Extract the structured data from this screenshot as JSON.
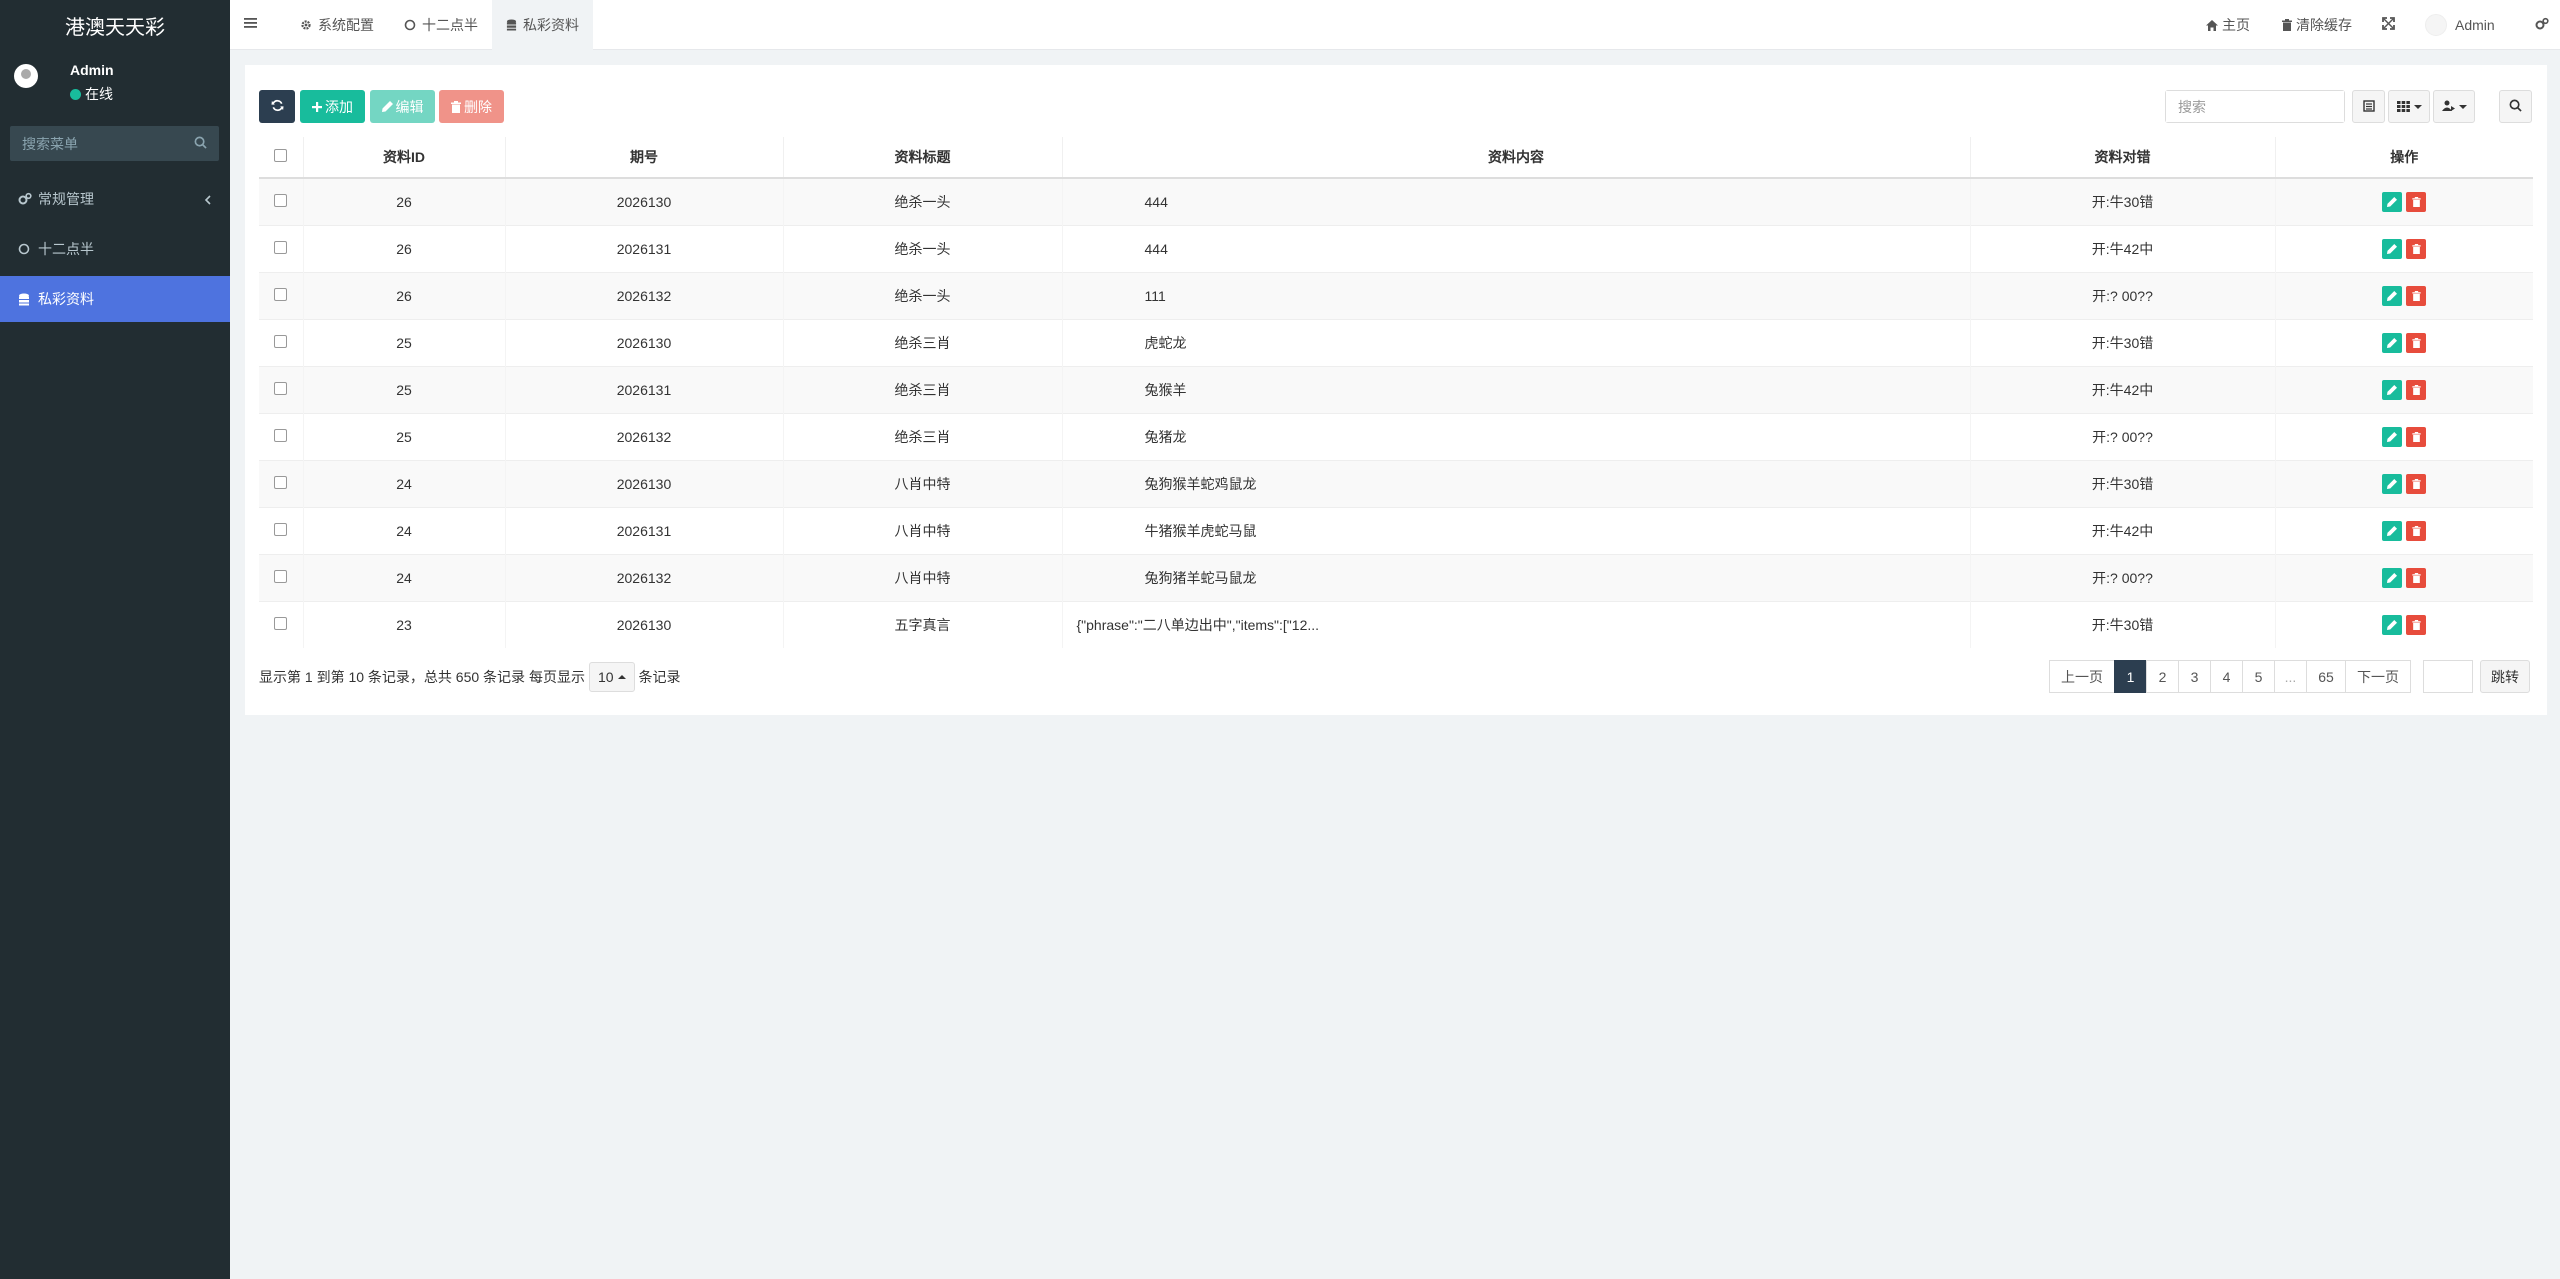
{
  "app": {
    "logo": "港澳天天彩"
  },
  "user": {
    "name": "Admin",
    "status": "在线"
  },
  "sidebar": {
    "search_placeholder": "搜索菜单",
    "items": [
      {
        "label": "常规管理",
        "icon": "cogs-icon"
      },
      {
        "label": "十二点半",
        "icon": "circle-icon"
      },
      {
        "label": "私彩资料",
        "icon": "database-icon",
        "active": true
      }
    ]
  },
  "topbar": {
    "tabs": [
      {
        "label": "系统配置",
        "icon": "gear-icon"
      },
      {
        "label": "十二点半",
        "icon": "circle-icon"
      },
      {
        "label": "私彩资料",
        "icon": "database-icon",
        "active": true
      }
    ],
    "home": "主页",
    "clear_cache": "清除缓存",
    "admin": "Admin"
  },
  "toolbar": {
    "add": "添加",
    "edit": "编辑",
    "delete": "删除",
    "search_placeholder": "搜索"
  },
  "table": {
    "columns": [
      "资料ID",
      "期号",
      "资料标题",
      "资料内容",
      "资料对错",
      "操作"
    ],
    "rows": [
      {
        "id": "26",
        "issue": "2026130",
        "title": "绝杀一头",
        "content": "444",
        "result": "开:牛30错"
      },
      {
        "id": "26",
        "issue": "2026131",
        "title": "绝杀一头",
        "content": "444",
        "result": "开:牛42中"
      },
      {
        "id": "26",
        "issue": "2026132",
        "title": "绝杀一头",
        "content": "111",
        "result": "开:?  00??"
      },
      {
        "id": "25",
        "issue": "2026130",
        "title": "绝杀三肖",
        "content": "虎蛇龙",
        "result": "开:牛30错"
      },
      {
        "id": "25",
        "issue": "2026131",
        "title": "绝杀三肖",
        "content": "兔猴羊",
        "result": "开:牛42中"
      },
      {
        "id": "25",
        "issue": "2026132",
        "title": "绝杀三肖",
        "content": "兔猪龙",
        "result": "开:?  00??"
      },
      {
        "id": "24",
        "issue": "2026130",
        "title": "八肖中特",
        "content": "兔狗猴羊蛇鸡鼠龙",
        "result": "开:牛30错"
      },
      {
        "id": "24",
        "issue": "2026131",
        "title": "八肖中特",
        "content": "牛猪猴羊虎蛇马鼠",
        "result": "开:牛42中"
      },
      {
        "id": "24",
        "issue": "2026132",
        "title": "八肖中特",
        "content": "兔狗猪羊蛇马鼠龙",
        "result": "开:?  00??"
      },
      {
        "id": "23",
        "issue": "2026130",
        "title": "五字真言",
        "content": "{\"phrase\":\"二八单边出中\",\"items\":[\"12...",
        "result": "开:牛30错"
      }
    ]
  },
  "footer": {
    "info_prefix": "显示第 1 到第 10 条记录，总共 650 条记录 每页显示",
    "page_size": "10",
    "info_suffix": "条记录"
  },
  "pagination": {
    "prev": "上一页",
    "pages": [
      "1",
      "2",
      "3",
      "4",
      "5",
      "...",
      "65"
    ],
    "next": "下一页",
    "jump": "跳转"
  },
  "colors": {
    "sidebar": "#222d32",
    "active": "#4e73df",
    "primary": "#18bc9c",
    "danger": "#e74c3c",
    "dark": "#2c3e50"
  }
}
